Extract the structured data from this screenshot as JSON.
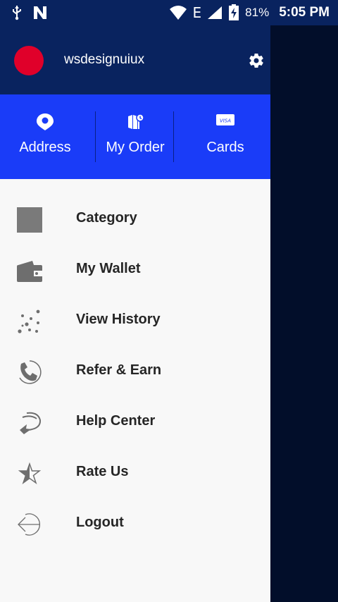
{
  "status_bar": {
    "battery_percent": "81%",
    "time": "5:05 PM",
    "network_type": "E",
    "icons": [
      "usb-icon",
      "n-notification-icon",
      "wifi-icon",
      "signal-icon",
      "battery-charging-icon"
    ]
  },
  "header": {
    "username": "wsdesignuiux",
    "avatar_color": "#e0002a",
    "background": "#09235f"
  },
  "quick_actions": [
    {
      "label": "Address",
      "icon": "location-pin-icon"
    },
    {
      "label": "My Order",
      "icon": "orders-icon"
    },
    {
      "label": "Cards",
      "icon": "visa-card-icon"
    }
  ],
  "menu": [
    {
      "label": "Category",
      "icon": "category-icon"
    },
    {
      "label": "My Wallet",
      "icon": "wallet-icon"
    },
    {
      "label": "View History",
      "icon": "history-dots-icon"
    },
    {
      "label": "Refer & Earn",
      "icon": "phone-icon"
    },
    {
      "label": "Help Center",
      "icon": "help-arrow-icon"
    },
    {
      "label": "Rate Us",
      "icon": "star-icon"
    },
    {
      "label": "Logout",
      "icon": "logout-icon"
    }
  ],
  "colors": {
    "accent": "#1a3cf8",
    "header": "#09235f",
    "scrim": "#020e2a",
    "icon_gray": "#707070"
  }
}
